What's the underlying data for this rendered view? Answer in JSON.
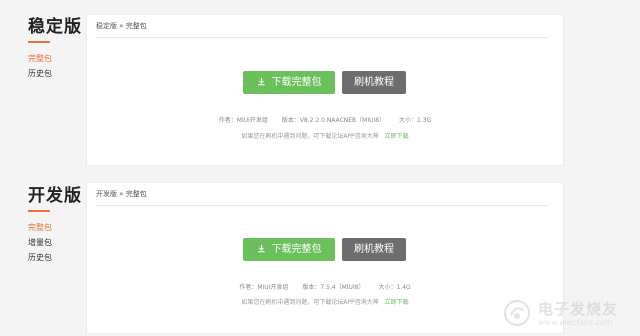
{
  "stable": {
    "title": "稳定版",
    "nav": [
      "完整包",
      "历史包"
    ],
    "breadcrumb": "稳定版 » 完整包",
    "download_label": "下载完整包",
    "tutorial_label": "刷机教程",
    "author": "作者：MIUI开发组",
    "version": "版本：V8.2.2.0.NAACNEB（MIUI8）",
    "size": "大小：1.3G",
    "note": "如果您在刷机中遇到问题，可下载论坛APP咨询大神",
    "note_link": "立即下载"
  },
  "dev": {
    "title": "开发版",
    "nav": [
      "完整包",
      "增量包",
      "历史包"
    ],
    "breadcrumb": "开发版 » 完整包",
    "download_label": "下载完整包",
    "tutorial_label": "刷机教程",
    "author": "作者：MIUI开发组",
    "version": "版本：7.5.4（MIUI8）",
    "size": "大小：1.4G",
    "note": "如果您在刷机中遇到问题，可下载论坛APP咨询大神",
    "note_link": "立即下载"
  },
  "watermark": {
    "cn": "电子发烧友",
    "en": "www.elecfans.com"
  },
  "colors": {
    "accent": "#e8743b",
    "download_button": "#6ac15c",
    "tutorial_button": "#6d6d6d",
    "background": "#f4f4f4"
  }
}
